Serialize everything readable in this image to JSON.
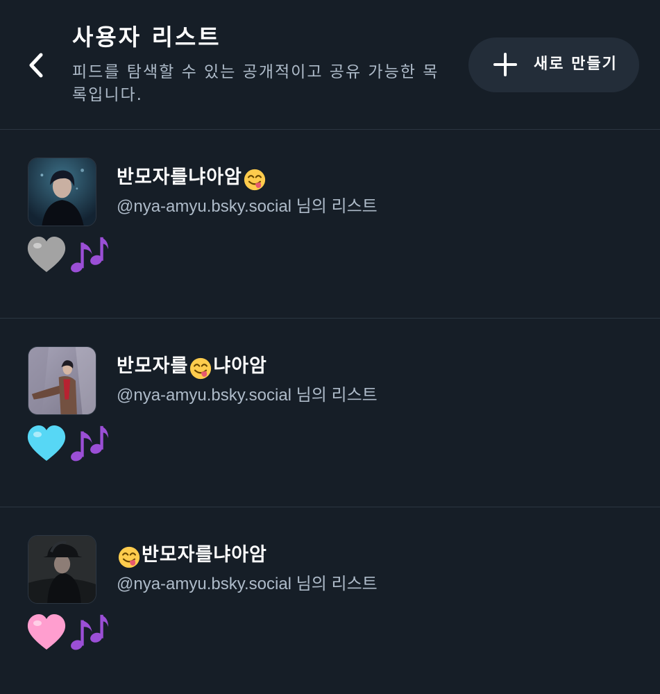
{
  "header": {
    "title": "사용자 리스트",
    "subtitle": "피드를 탐색할 수 있는 공개적이고 공유 가능한 목록입니다.",
    "back_icon": "chevron-left-icon",
    "new_button": {
      "icon": "plus-icon",
      "label": "새로 만들기"
    }
  },
  "lists": [
    {
      "name_before": "반모자를냐아암",
      "name_after": "",
      "name_emoji": "face-savoring-food",
      "owner": "@nya-amyu.bsky.social 님의 리스트",
      "heart_color": "#a3a3a3",
      "heart_icon": "grey-heart-icon",
      "note_icon": "musical-notes-icon"
    },
    {
      "name_before": "반모자를",
      "name_after": "냐아암",
      "name_emoji": "face-savoring-food",
      "owner": "@nya-amyu.bsky.social 님의 리스트",
      "heart_color": "#57d7f5",
      "heart_icon": "light-blue-heart-icon",
      "note_icon": "musical-notes-icon"
    },
    {
      "name_before": "",
      "name_after": "반모자를냐아암",
      "name_emoji": "face-savoring-food",
      "owner": "@nya-amyu.bsky.social 님의 리스트",
      "heart_color": "#ff9ecf",
      "heart_icon": "pink-heart-icon",
      "note_icon": "musical-notes-icon"
    }
  ],
  "colors": {
    "background": "#161e27",
    "button_bg": "#232d39",
    "secondary_text": "#aebbc9",
    "divider": "#2c3642",
    "notes": "#9b4fd6"
  }
}
